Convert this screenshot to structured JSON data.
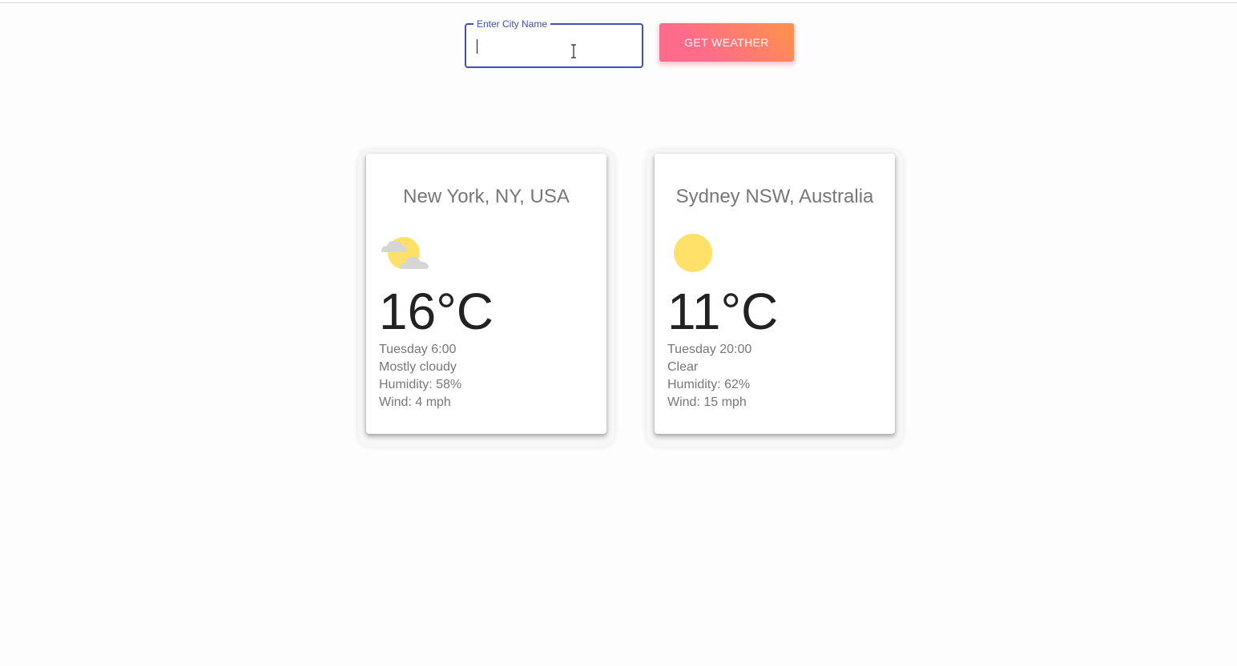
{
  "search": {
    "label": "Enter City Name",
    "value": "",
    "button_label": "GET WEATHER"
  },
  "colors": {
    "field_accent": "#3f51b5",
    "button_gradient_start": "#fe6b8b",
    "button_gradient_end": "#ff8e53",
    "sun": "#ffe16a",
    "cloud": "#d6d6d6"
  },
  "cards": [
    {
      "city": "New York, NY, USA",
      "icon": "partly-cloudy-icon",
      "temperature": "16°C",
      "day_time": "Tuesday 6:00",
      "condition": "Mostly cloudy",
      "humidity": "Humidity: 58%",
      "wind": "Wind: 4 mph"
    },
    {
      "city": "Sydney NSW, Australia",
      "icon": "sun-icon",
      "temperature": "11°C",
      "day_time": "Tuesday 20:00",
      "condition": "Clear",
      "humidity": "Humidity: 62%",
      "wind": "Wind: 15 mph"
    }
  ]
}
